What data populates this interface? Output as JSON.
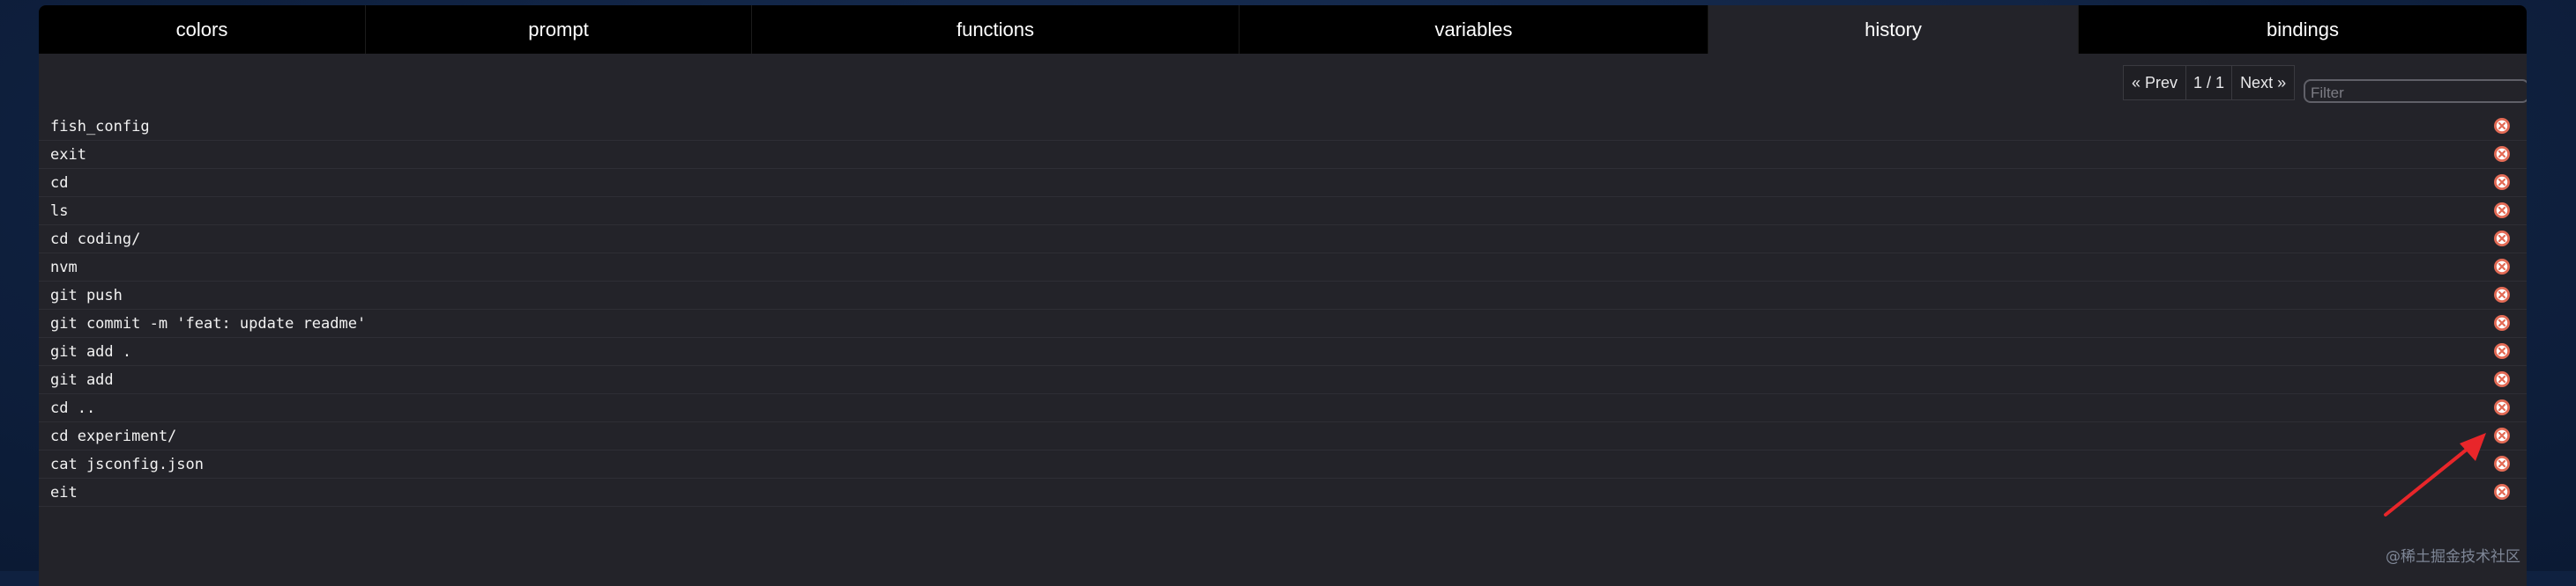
{
  "tabs": [
    {
      "label": "colors",
      "active": false
    },
    {
      "label": "prompt",
      "active": false
    },
    {
      "label": "functions",
      "active": false
    },
    {
      "label": "variables",
      "active": false
    },
    {
      "label": "history",
      "active": true
    },
    {
      "label": "bindings",
      "active": false
    }
  ],
  "pager": {
    "prev_label": "« Prev",
    "page": "1 / 1",
    "next_label": "Next »"
  },
  "filter": {
    "placeholder": "Filter",
    "value": ""
  },
  "history": [
    "fish_config",
    "exit",
    "cd",
    "ls",
    "cd coding/",
    "nvm",
    "git push",
    "git commit -m 'feat: update readme'",
    "git add .",
    "git add",
    "cd ..",
    "cd experiment/",
    "cat jsconfig.json",
    "eit"
  ],
  "colors": {
    "delete_icon": "#e26a55",
    "annotation_arrow": "#e8262a"
  },
  "watermark": "@稀土掘金技术社区"
}
